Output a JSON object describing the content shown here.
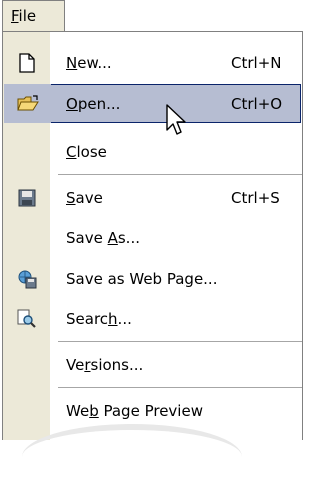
{
  "menubar": {
    "file_label": "File",
    "file_mnemonic": "F",
    "file_rest": "ile"
  },
  "menu": {
    "items": [
      {
        "pre": "",
        "mn": "N",
        "post": "ew...",
        "shortcut": "Ctrl+N",
        "icon": "new-document-icon"
      },
      {
        "pre": "",
        "mn": "O",
        "post": "pen...",
        "shortcut": "Ctrl+O",
        "icon": "open-folder-icon"
      },
      {
        "pre": "",
        "mn": "C",
        "post": "lose",
        "shortcut": "",
        "icon": ""
      },
      {
        "pre": "",
        "mn": "S",
        "post": "ave",
        "shortcut": "Ctrl+S",
        "icon": "save-disk-icon"
      },
      {
        "pre": "Save ",
        "mn": "A",
        "post": "s...",
        "shortcut": "",
        "icon": ""
      },
      {
        "pre": "Save as Web Pa",
        "mn": "g",
        "post": "e...",
        "shortcut": "",
        "icon": "save-web-page-icon"
      },
      {
        "pre": "Searc",
        "mn": "h",
        "post": "...",
        "shortcut": "",
        "icon": "search-icon"
      },
      {
        "pre": "Ve",
        "mn": "r",
        "post": "sions...",
        "shortcut": "",
        "icon": ""
      },
      {
        "pre": "We",
        "mn": "b",
        "post": " Page Preview",
        "shortcut": "",
        "icon": ""
      }
    ]
  },
  "colors": {
    "highlight": "#b6bdd2",
    "highlight_border": "#0a246a",
    "gutter": "#ece9d8"
  }
}
